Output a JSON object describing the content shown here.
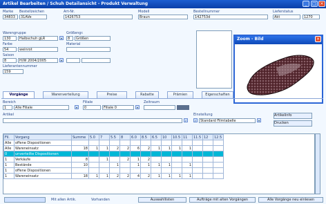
{
  "window": {
    "title": "Artikel Bearbeiten / Schuh Detailansicht - Produkt Verwaltung"
  },
  "header": {
    "labels": {
      "marke": "Marke",
      "ref": "Bestellzeichen",
      "artnr": "Art-Nr.",
      "modell": "Modell",
      "saison": "Bestellnummer",
      "status": "Lieferstatus"
    },
    "values": {
      "marke": "34833",
      "ref": "31AVe",
      "artnr": "1426753",
      "modell": "Braun",
      "saison": "142753d",
      "status1": "Akt",
      "status2": "1270"
    }
  },
  "left": {
    "warengruppe_label": "Warengruppe",
    "warengruppe_code": "130",
    "warengruppe_value": "Halbschuh gLR",
    "farbe_label": "Farbe",
    "farbe_code": "54",
    "farbe_value": "weinrot",
    "saison_label": "Saison",
    "saison_code": "8",
    "saison_value": "H/W 2004/2005",
    "lieferant_label": "Lieferantennummer",
    "lieferant_value": "159",
    "groessen_label": "Größengr.",
    "groessen_code": "8",
    "groessen_value": "Größen",
    "material_label": "Material"
  },
  "popup": {
    "title": "Zoom - Bild"
  },
  "tabs": [
    "Vorgänge",
    "Warenverteilung",
    "Preise",
    "Rabatte",
    "Prämien",
    "Eigenschaften"
  ],
  "vorgaenge": {
    "bereich_label": "Bereich",
    "bereich_code": "1",
    "bereich_value": "Alle Filiale",
    "filiale_label": "Filiale",
    "filiale_code": "0",
    "filiale_value": "Filiale 0",
    "zeitraum_label": "Zeitraum",
    "artikel_label": "Artikel",
    "einstellung_label": "Einstellung",
    "einstellung_value": "Standard Filmtabelle",
    "side_buttons": [
      "Artikelinfo",
      "Drucken"
    ]
  },
  "grid": {
    "headers": [
      "Fil.",
      "Vorgang",
      "Summe",
      "5.0",
      "7",
      "5.5",
      "8",
      "6.0",
      "8.5",
      "6.5",
      "10",
      "10.5",
      "11",
      "11.5",
      "12",
      "12.5"
    ],
    "rows": [
      {
        "fil": "Alle",
        "vorgang": "offene Dispositionen",
        "sum": "",
        "vals": [
          "",
          "",
          "",
          "",
          "",
          "",
          "",
          "",
          "",
          "",
          "",
          "",
          ""
        ]
      },
      {
        "fil": "Alle",
        "vorgang": "Wareneinsatz",
        "sum": "18",
        "vals": [
          "1",
          "1",
          "2",
          "2",
          "6",
          "2",
          "1",
          "1",
          "1",
          "1",
          "",
          "",
          ""
        ]
      },
      {
        "fil": "0",
        "vorgang": "unverteilte Dispositionen",
        "sum": "",
        "vals": [
          "",
          "",
          "",
          "",
          "",
          "",
          "",
          "",
          "",
          "",
          "",
          "",
          ""
        ],
        "selected": true
      },
      {
        "fil": "1",
        "vorgang": "Verkäufe",
        "sum": "8",
        "vals": [
          "",
          "1",
          "",
          "2",
          "1",
          "2",
          "",
          "",
          "",
          "",
          "",
          "",
          ""
        ]
      },
      {
        "fil": "1",
        "vorgang": "Bestände",
        "sum": "10",
        "vals": [
          "",
          "",
          "1",
          "",
          "1",
          "1",
          "1",
          "1",
          "",
          "1",
          "",
          "",
          ""
        ]
      },
      {
        "fil": "1",
        "vorgang": "offene Dispositionen",
        "sum": "",
        "vals": [
          "",
          "",
          "",
          "",
          "",
          "",
          "",
          "",
          "",
          "",
          "",
          "",
          ""
        ]
      },
      {
        "fil": "1",
        "vorgang": "Wareneinsatz",
        "sum": "18",
        "vals": [
          "1",
          "1",
          "2",
          "2",
          "4",
          "2",
          "1",
          "1",
          "1",
          "1",
          "",
          "",
          ""
        ]
      }
    ]
  },
  "bottom": {
    "labels": [
      "Mit allen Artik.",
      "Vorhanden"
    ],
    "buttons": [
      "Auswahllisten",
      "Aufträge mit alten Vorgängen",
      "Alle Vorgänge neu einlesen"
    ]
  }
}
